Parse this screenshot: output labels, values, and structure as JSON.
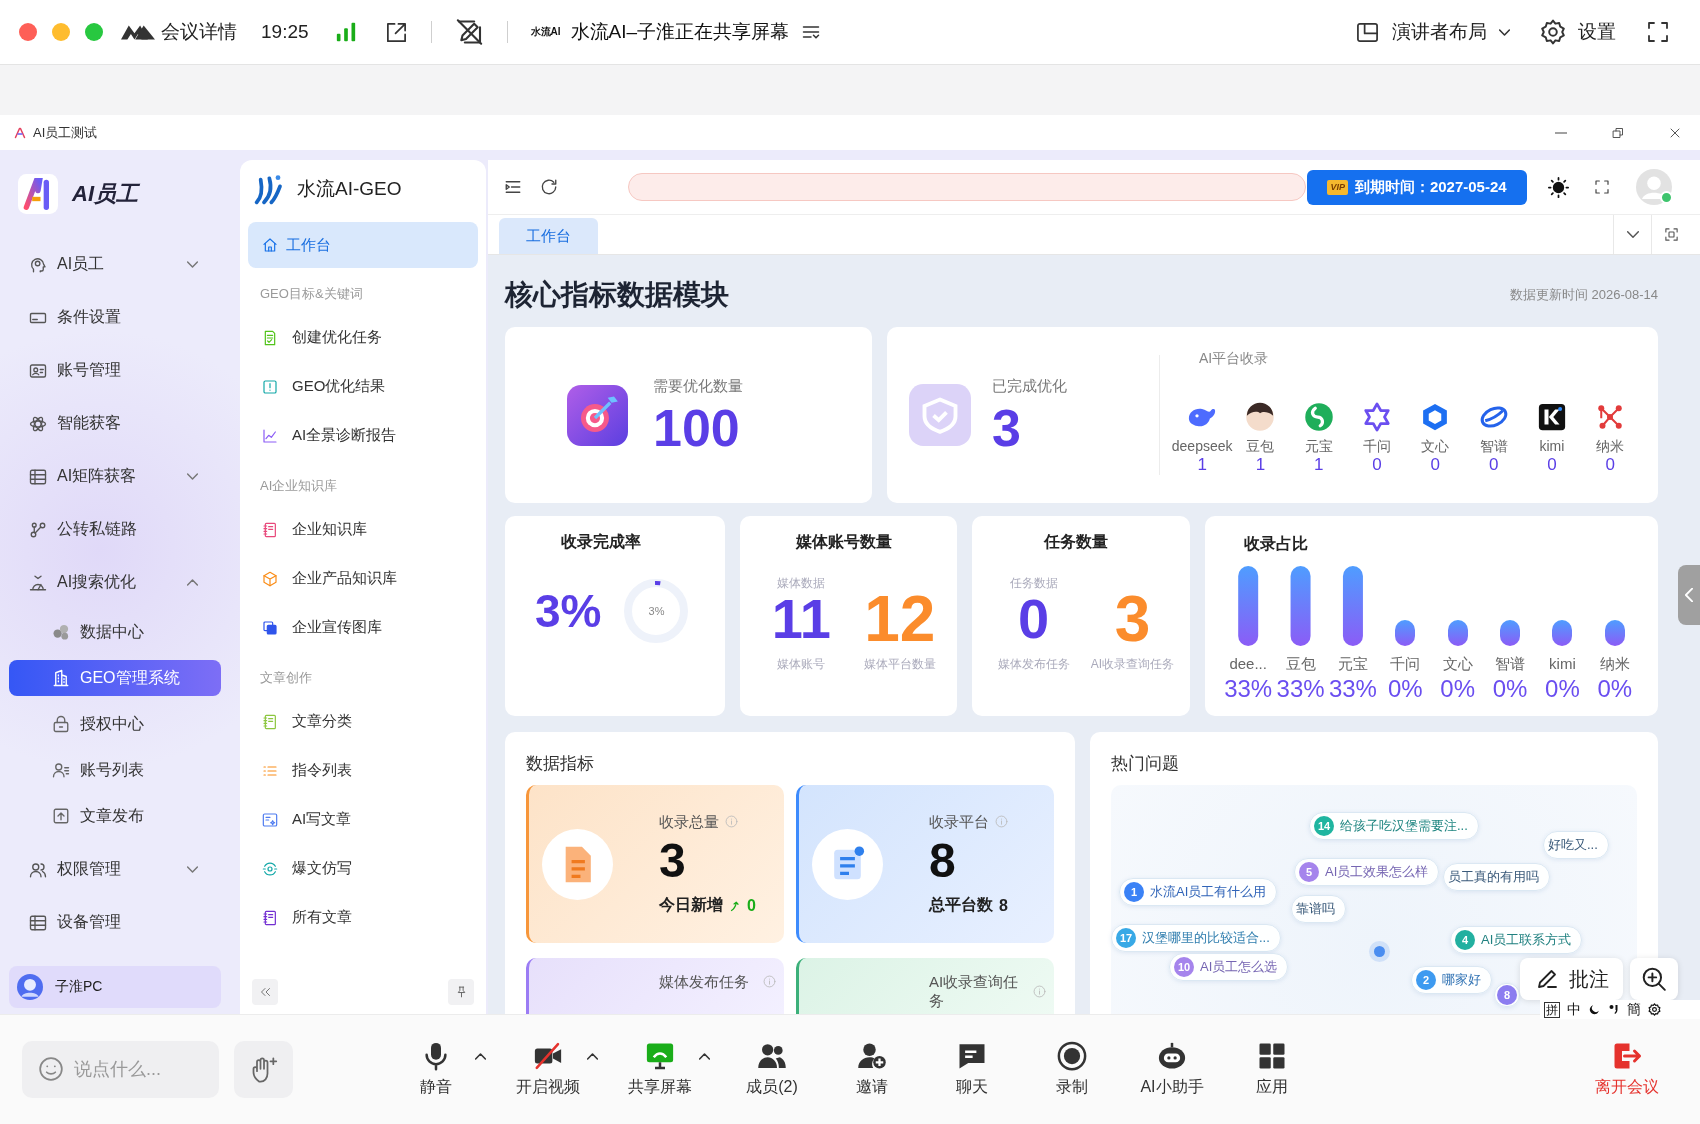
{
  "meeting_bar": {
    "title": "会议详情",
    "time": "19:25",
    "app_logo_text": "水流AI",
    "sharing_status": "水流AI–子淮正在共享屏幕",
    "layout_menu": "演讲者布局",
    "settings": "设置"
  },
  "app_window": {
    "title": "AI员工测试"
  },
  "sidebar": {
    "brand": "AI员工",
    "items": [
      {
        "label": "AI员工",
        "kind": "group",
        "expanded": false,
        "selected": false
      },
      {
        "label": "条件设置",
        "kind": "link",
        "selected": false
      },
      {
        "label": "账号管理",
        "kind": "link",
        "selected": false
      },
      {
        "label": "智能获客",
        "kind": "link",
        "selected": false
      },
      {
        "label": "AI矩阵获客",
        "kind": "group",
        "expanded": false,
        "selected": false
      },
      {
        "label": "公转私链路",
        "kind": "link",
        "selected": false
      },
      {
        "label": "AI搜索优化",
        "kind": "group",
        "expanded": true,
        "selected": false,
        "children": [
          {
            "label": "数据中心",
            "selected": false
          },
          {
            "label": "GEO管理系统",
            "selected": true
          },
          {
            "label": "授权中心",
            "selected": false
          },
          {
            "label": "账号列表",
            "selected": false
          },
          {
            "label": "文章发布",
            "selected": false
          }
        ]
      },
      {
        "label": "权限管理",
        "kind": "group",
        "expanded": false,
        "selected": false
      },
      {
        "label": "设备管理",
        "kind": "link",
        "selected": false
      }
    ],
    "user": "子淮PC"
  },
  "nav": {
    "title": "水流AI-GEO",
    "home": {
      "label": "工作台",
      "selected": true
    },
    "sections": [
      {
        "title": "GEO目标&关键词",
        "items": [
          {
            "label": "创建优化任务",
            "selected": false
          },
          {
            "label": "GEO优化结果",
            "selected": false
          },
          {
            "label": "AI全景诊断报告",
            "selected": false
          }
        ]
      },
      {
        "title": "AI企业知识库",
        "items": [
          {
            "label": "企业知识库",
            "selected": false
          },
          {
            "label": "企业产品知识库",
            "selected": false
          },
          {
            "label": "企业宣传图库",
            "selected": false
          }
        ]
      },
      {
        "title": "文章创作",
        "items": [
          {
            "label": "文章分类",
            "selected": false
          },
          {
            "label": "指令列表",
            "selected": false
          },
          {
            "label": "AI写文章",
            "selected": false
          },
          {
            "label": "爆文仿写",
            "selected": false
          },
          {
            "label": "所有文章",
            "selected": false
          }
        ]
      }
    ]
  },
  "header": {
    "vip_badge": "VIP",
    "expiry": "到期时间：2027-05-24",
    "online": true
  },
  "tabs": [
    {
      "label": "工作台",
      "selected": true
    }
  ],
  "dashboard": {
    "title": "核心指标数据模块",
    "updated": "数据更新时间 2026-08-14",
    "optimize": {
      "label": "需要优化数量",
      "value": "100"
    },
    "completed": {
      "label": "已完成优化",
      "value": "3"
    },
    "platforms": {
      "title": "AI平台收录",
      "items": [
        {
          "name": "deepseek",
          "count": "1"
        },
        {
          "name": "豆包",
          "count": "1"
        },
        {
          "name": "元宝",
          "count": "1"
        },
        {
          "name": "千问",
          "count": "0"
        },
        {
          "name": "文心",
          "count": "0"
        },
        {
          "name": "智谱",
          "count": "0"
        },
        {
          "name": "kimi",
          "count": "0"
        },
        {
          "name": "纳米",
          "count": "0"
        }
      ]
    },
    "rate": {
      "title": "收录完成率",
      "value": "3%",
      "ring_label": "3%",
      "level": 0.03
    },
    "media": {
      "title": "媒体账号数量",
      "caption": "媒体数据",
      "stats": [
        {
          "value": "11",
          "label": "媒体账号"
        },
        {
          "value": "12",
          "label": "媒体平台数量"
        }
      ]
    },
    "tasks": {
      "title": "任务数量",
      "caption": "任务数据",
      "stats": [
        {
          "value": "0",
          "label": "媒体发布任务"
        },
        {
          "value": "3",
          "label": "AI收录查询任务"
        }
      ]
    },
    "share": {
      "chart_data": {
        "type": "bar",
        "title": "收录占比",
        "categories": [
          "dee...",
          "豆包",
          "元宝",
          "千问",
          "文心",
          "智谱",
          "kimi",
          "纳米"
        ],
        "values": [
          33,
          33,
          33,
          0,
          0,
          0,
          0,
          0
        ],
        "value_labels": [
          "33%",
          "33%",
          "33%",
          "0%",
          "0%",
          "0%",
          "0%",
          "0%"
        ]
      }
    },
    "metrics": {
      "title": "数据指标",
      "cards": [
        {
          "kind": "growth",
          "label": "收录总量",
          "value": "3",
          "sub_label": "今日新增",
          "sub_value": "0"
        },
        {
          "kind": "total",
          "label": "收录平台",
          "value": "8",
          "sub_label": "总平台数",
          "sub_value": "8"
        },
        {
          "kind": "task",
          "label": "媒体发布任务"
        },
        {
          "kind": "task",
          "label": "AI收录查询任务"
        }
      ]
    },
    "hot": {
      "title": "热门问题",
      "bubbles": [
        {
          "number": "14",
          "text": "给孩子吃汉堡需要注...",
          "color": "#1fb5a0"
        },
        {
          "text": "好吃又..."
        },
        {
          "number": "5",
          "text": "AI员工效果怎么样",
          "color": "#a584ec"
        },
        {
          "text": "员工真的有用吗"
        },
        {
          "number": "1",
          "text": "水流AI员工有什么用",
          "color": "#3b82f6"
        },
        {
          "text": "靠谱吗"
        },
        {
          "number": "17",
          "text": "汉堡哪里的比较适合...",
          "color": "#38a9e6"
        },
        {
          "number": "4",
          "text": "AI员工联系方式",
          "color": "#22b0a0"
        },
        {
          "number": "10",
          "text": "AI员工怎么选",
          "color": "#a584ec"
        },
        {
          "number": "2",
          "text": "哪家好",
          "color": "#3d9af0"
        },
        {
          "number": "8",
          "color": "#8c7df0"
        }
      ]
    }
  },
  "toolbar": {
    "chat_placeholder": "说点什么...",
    "buttons": [
      {
        "label": "静音",
        "menu": true
      },
      {
        "label": "开启视频",
        "menu": true
      },
      {
        "label": "共享屏幕",
        "menu": true
      },
      {
        "label": "成员(2)",
        "menu": false
      },
      {
        "label": "邀请",
        "menu": false
      },
      {
        "label": "聊天",
        "menu": false
      },
      {
        "label": "录制",
        "menu": false
      },
      {
        "label": "AI小助手",
        "menu": false
      },
      {
        "label": "应用",
        "menu": false
      }
    ],
    "leave": "离开会议"
  },
  "overlay": {
    "annotate": "批注"
  },
  "ime": {
    "input": "拼",
    "mode": "中",
    "script": "簡"
  }
}
